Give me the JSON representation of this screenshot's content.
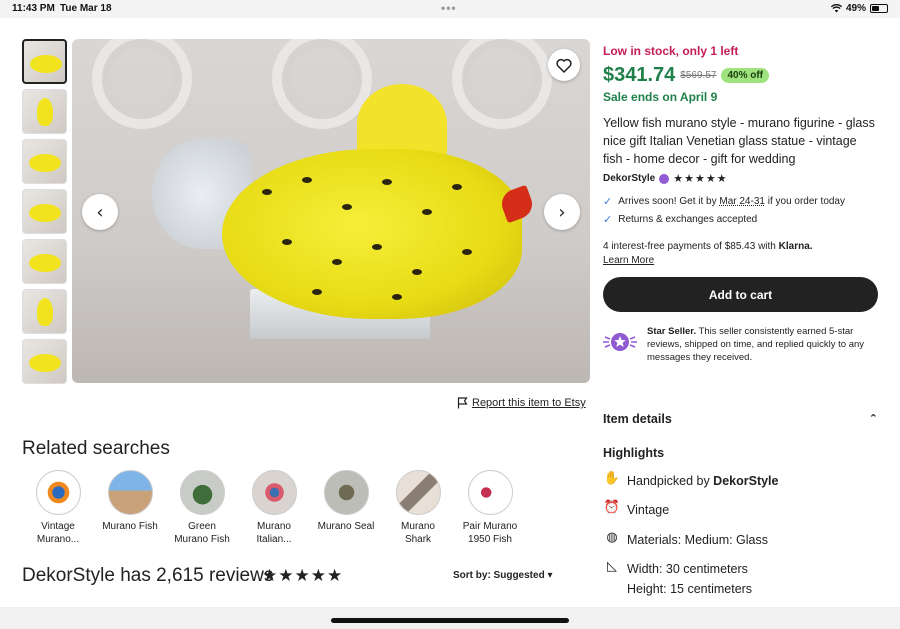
{
  "status_bar": {
    "time": "11:43 PM",
    "date": "Tue Mar 18",
    "battery": "49%",
    "battery_level": 0.49
  },
  "gallery": {
    "thumbnail_count": 7,
    "active_index": 0
  },
  "report": {
    "label": "Report this item to Etsy"
  },
  "related": {
    "title": "Related searches",
    "items": [
      {
        "label": "Vintage\nMurano..."
      },
      {
        "label": "Murano Fish"
      },
      {
        "label": "Green\nMurano Fish"
      },
      {
        "label": "Murano\nItalian..."
      },
      {
        "label": "Murano Seal"
      },
      {
        "label": "Murano\nShark"
      },
      {
        "label": "Pair Murano\n1950 Fish"
      }
    ]
  },
  "reviews": {
    "title": "DekorStyle has 2,615 reviews",
    "stars": "★★★★★",
    "sort_label": "Sort by: Suggested ▾"
  },
  "product": {
    "stock": "Low in stock, only 1 left",
    "price": "$341.74",
    "original_price": "$569.57",
    "discount": "40% off",
    "sale_ends": "Sale ends on April 9",
    "title": "Yellow fish murano style - murano figurine - glass nice gift Italian Venetian glass statue - vintage fish - home decor - gift for wedding",
    "shop_name": "DekorStyle",
    "shop_stars": "★★★★★",
    "arrival_prefix": "Arrives soon! Get it by ",
    "arrival_date": "Mar 24-31",
    "arrival_suffix": " if you order today",
    "returns": "Returns & exchanges accepted",
    "klarna_prefix": "4 interest-free payments of $85.43 with ",
    "klarna_brand": "Klarna.",
    "learn_more": "Learn More",
    "add_to_cart": "Add to cart",
    "star_seller_bold": "Star Seller.",
    "star_seller_text": " This seller consistently earned 5-star reviews, shipped on time, and replied quickly to any messages they received."
  },
  "details": {
    "section_title": "Item details",
    "highlights_title": "Highlights",
    "handpicked_prefix": "Handpicked by ",
    "handpicked_shop": "DekorStyle",
    "vintage": "Vintage",
    "materials": "Materials: Medium: Glass",
    "width": "Width: 30 centimeters",
    "height": "Height: 15 centimeters"
  },
  "colors": {
    "price_green": "#21804a",
    "stock_red": "#c51d54",
    "discount_badge": "#9ee37d",
    "cart_button": "#222222",
    "check_blue": "#3b78d8",
    "star_seller_purple": "#8f5bd0"
  },
  "icons": {
    "favorite": "heart-outline-icon",
    "prev": "chevron-left-icon",
    "next": "chevron-right-icon",
    "report": "flag-icon",
    "check": "checkmark-icon",
    "star_seller": "star-seller-badge-icon",
    "collapse": "chevron-up-icon",
    "handpicked": "hand-icon",
    "vintage": "alarm-clock-icon",
    "materials": "yarn-ball-icon",
    "dimensions": "ruler-triangle-icon"
  }
}
